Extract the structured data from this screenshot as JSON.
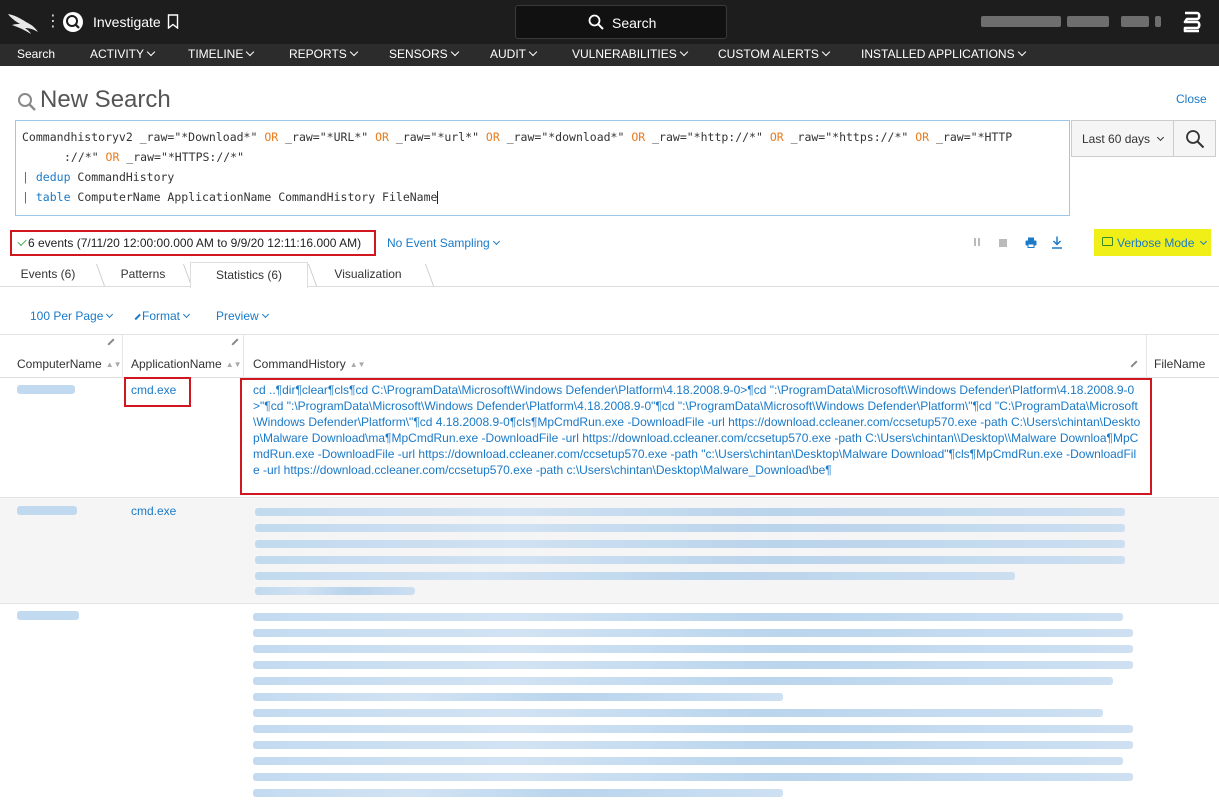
{
  "app": {
    "title": "Investigate",
    "search_label": "Search"
  },
  "nav": {
    "items": [
      {
        "label": "Search",
        "dropdown": false
      },
      {
        "label": "ACTIVITY",
        "dropdown": true
      },
      {
        "label": "TIMELINE",
        "dropdown": true
      },
      {
        "label": "REPORTS",
        "dropdown": true
      },
      {
        "label": "SENSORS",
        "dropdown": true
      },
      {
        "label": "AUDIT",
        "dropdown": true
      },
      {
        "label": "VULNERABILITIES",
        "dropdown": true
      },
      {
        "label": "CUSTOM ALERTS",
        "dropdown": true
      },
      {
        "label": "INSTALLED APPLICATIONS",
        "dropdown": true
      }
    ]
  },
  "page": {
    "title": "New Search",
    "close_label": "Close"
  },
  "query": {
    "line1_a": "Commandhistoryv2 _raw=\"*Download*\" ",
    "op1": "OR",
    "line1_b": " _raw=\"*URL*\" ",
    "op2": "OR",
    "line1_c": " _raw=\"*url*\" ",
    "op3": "OR",
    "line1_d": " _raw=\"*download*\" ",
    "op4": "OR",
    "line1_e": " _raw=\"*http://*\" ",
    "op5": "OR",
    "line1_f": " _raw=\"*https://*\" ",
    "op6": "OR",
    "line1_g": " _raw=\"*HTTP",
    "line2_a": "://*\" ",
    "op7": "OR",
    "line2_b": " _raw=\"*HTTPS://*\"",
    "pipe": "|",
    "cmd1": "dedup",
    "arg1": " CommandHistory",
    "cmd2": "table",
    "arg2": " ComputerName ApplicationName CommandHistory FileName"
  },
  "time_range": {
    "selected": "Last 60 days"
  },
  "status": {
    "events_text": "6 events (7/11/20 12:00:00.000 AM to 9/9/20 12:11:16.000 AM)",
    "sampling": "No Event Sampling",
    "mode": "Verbose Mode"
  },
  "tabs": [
    {
      "label": "Events (6)",
      "active": false
    },
    {
      "label": "Patterns",
      "active": false
    },
    {
      "label": "Statistics (6)",
      "active": true
    },
    {
      "label": "Visualization",
      "active": false
    }
  ],
  "table_tools": {
    "per_page": "100 Per Page",
    "format": "Format",
    "preview": "Preview"
  },
  "table": {
    "columns": [
      "ComputerName",
      "ApplicationName",
      "CommandHistory",
      "FileName"
    ],
    "rows": [
      {
        "application": "cmd.exe",
        "command": "cd ..¶dir¶clear¶cls¶cd C:\\ProgramData\\Microsoft\\Windows Defender\\Platform\\4.18.2008.9-0>¶cd \":\\ProgramData\\Microsoft\\Windows Defender\\Platform\\4.18.2008.9-0>\"¶cd \":\\ProgramData\\Microsoft\\Windows Defender\\Platform\\4.18.2008.9-0\"¶cd \":\\ProgramData\\Microsoft\\Windows Defender\\Platform\\\"¶cd \"C:\\ProgramData\\Microsoft\\Windows Defender\\Platform\\\"¶cd 4.18.2008.9-0¶cls¶MpCmdRun.exe -DownloadFile -url https://download.ccleaner.com/ccsetup570.exe -path C:\\Users\\chintan\\Desktop\\Malware Download\\ma¶MpCmdRun.exe -DownloadFile -url https://download.ccleaner.com/ccsetup570.exe -path C:\\Users\\chintan\\\\Desktop\\\\Malware Downloa¶MpCmdRun.exe -DownloadFile -url https://download.ccleaner.com/ccsetup570.exe -path \"c:\\Users\\chintan\\Desktop\\Malware Download\"¶cls¶MpCmdRun.exe -DownloadFile -url https://download.ccleaner.com/ccsetup570.exe -path c:\\Users\\chintan\\Desktop\\Malware_Download\\be¶"
      },
      {
        "application": "cmd.exe",
        "command": ""
      },
      {
        "application": "",
        "command": ""
      }
    ]
  },
  "colors": {
    "accent": "#1a7ac8",
    "highlight_box": "#d0161e",
    "verbose_bg": "#f0f018",
    "topbar": "#1d1d1d",
    "navbar": "#2c2c2c"
  }
}
